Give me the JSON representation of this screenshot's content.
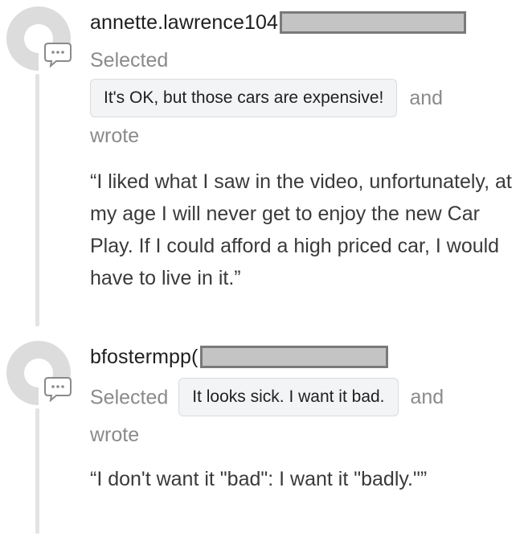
{
  "entries": [
    {
      "username": "annette.lawrence104",
      "selected_label": "Selected",
      "choice": "It's OK, but those cars are expensive!",
      "and_label": "and",
      "wrote_label": "wrote",
      "quote": "“I liked what I saw in the video, unfortunately, at my age I will never get to enjoy the new Car Play. If I could afford a high priced car, I would have to live in it.”"
    },
    {
      "username": "bfostermpp(",
      "selected_label": "Selected",
      "choice": "It looks sick. I want it bad.",
      "and_label": "and",
      "wrote_label": "wrote",
      "quote": "“I don't want it \"bad\": I want it \"badly.\"”"
    }
  ],
  "icons": [
    "avatar-placeholder-icon",
    "comment-bubble-icon"
  ],
  "colors": {
    "avatar_gray": "#dcdcdc",
    "badge_border": "#8a8a8a",
    "chip_background": "#f2f4f5",
    "muted_text": "#8a8a8a",
    "redaction_fill": "#c4c4c4"
  }
}
